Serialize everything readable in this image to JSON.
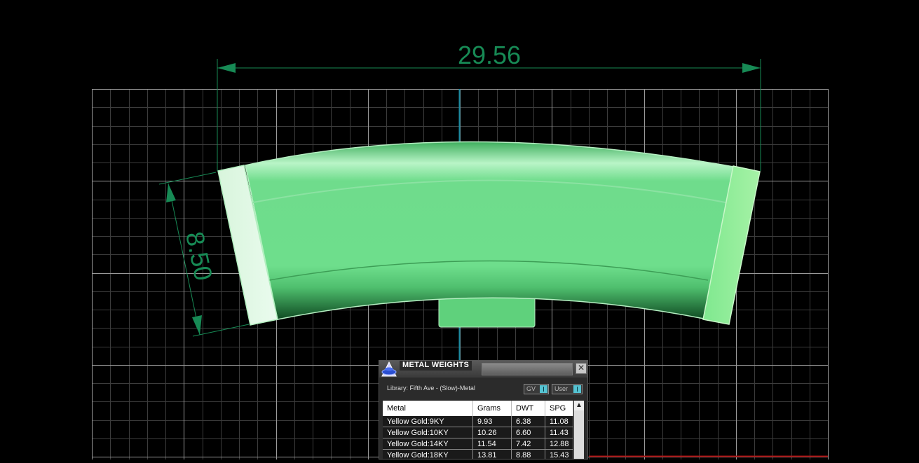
{
  "dimensions": {
    "width_value": "29.56",
    "height_value": "8.50",
    "dimension_color": "#178a55"
  },
  "model": {
    "color": "#6fdf8c"
  },
  "panel": {
    "title": "METAL WEIGHTS",
    "close_symbol": "✕",
    "library_label": "Library: Fifth Ave - (Slow)-Metal",
    "toggle_gv_label": "GV",
    "toggle_user_label": "User",
    "scroll_up_symbol": "▲",
    "logo_icon": "anvil-logo-icon",
    "columns": [
      "Metal",
      "Grams",
      "DWT",
      "SPG"
    ],
    "rows": [
      {
        "metal": "Yellow Gold:9KY",
        "grams": "9.93",
        "dwt": "6.38",
        "spg": "11.08"
      },
      {
        "metal": "Yellow Gold:10KY",
        "grams": "10.26",
        "dwt": "6.60",
        "spg": "11.43"
      },
      {
        "metal": "Yellow Gold:14KY",
        "grams": "11.54",
        "dwt": "7.42",
        "spg": "12.88"
      },
      {
        "metal": "Yellow Gold:18KY",
        "grams": "13.81",
        "dwt": "8.88",
        "spg": "15.43"
      }
    ]
  }
}
